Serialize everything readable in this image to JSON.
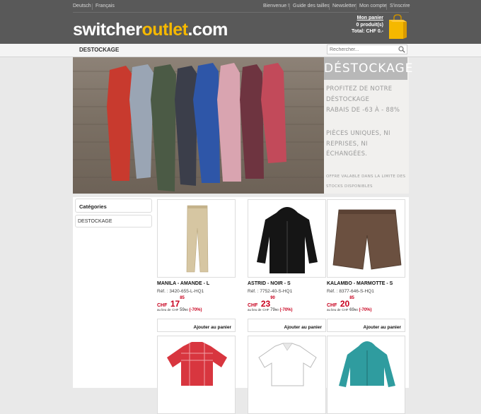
{
  "header": {
    "lang_links": [
      "Deutsch",
      "Français"
    ],
    "user_links": [
      "Bienvenue !",
      "Guide des tailles",
      "Newsletter",
      "Mon compte",
      "S'inscrire"
    ],
    "logo": {
      "part1": "switcher",
      "part2": "outlet",
      "part3": ".com"
    },
    "cart": {
      "title": "Mon panier",
      "count": "0 produit(s)",
      "total": "Total: CHF 0.-"
    }
  },
  "nav": {
    "current": "DESTOCKAGE",
    "search_placeholder": "Rechercher..."
  },
  "banner": {
    "title": "DÉSTOCKAGE",
    "line1": "PROFITEZ DE NOTRE",
    "line2": "DÉSTOCKAGE",
    "line3": "RABAIS DE -63 À - 88%",
    "line4": "PIÈCES UNIQUES, NI",
    "line5": "REPRISES, NI ÉCHANGÉES.",
    "footnote1": "OFFRE VALABLE DANS LA LIMITE DES",
    "footnote2": "STOCKS DISPONIBLES"
  },
  "sidebar": {
    "heading": "Catégories",
    "items": [
      "DESTOCKAGE"
    ]
  },
  "products": [
    {
      "name": "MANILA - AMANDE - L",
      "ref": "Réf. : 3420-655-L-HQ1",
      "currency": "CHF",
      "price_int": "17",
      "price_dec": "85",
      "old_label": "au lieu de",
      "old_currency": "CHF",
      "old_int": "59",
      "old_dec": "90",
      "discount": "(-70%)",
      "button": "Ajouter au panier"
    },
    {
      "name": "ASTRID - NOIR - S",
      "ref": "Réf. : 7752-40-S-HQ1",
      "currency": "CHF",
      "price_int": "23",
      "price_dec": "90",
      "old_label": "au lieu de",
      "old_currency": "CHF",
      "old_int": "79",
      "old_dec": "90",
      "discount": "(-70%)",
      "button": "Ajouter au panier"
    },
    {
      "name": "KALAMBO - MARMOTTE - S",
      "ref": "Réf. : 8377-646-S-HQ1",
      "currency": "CHF",
      "price_int": "20",
      "price_dec": "85",
      "old_label": "au lieu de",
      "old_currency": "CHF",
      "old_int": "69",
      "old_dec": "90",
      "discount": "(-70%)",
      "button": "Ajouter au panier"
    }
  ],
  "colors": {
    "header_bg": "#595959",
    "logo_accent": "#f5b800",
    "price_red": "#c8001e",
    "bag": "#f5b800"
  }
}
